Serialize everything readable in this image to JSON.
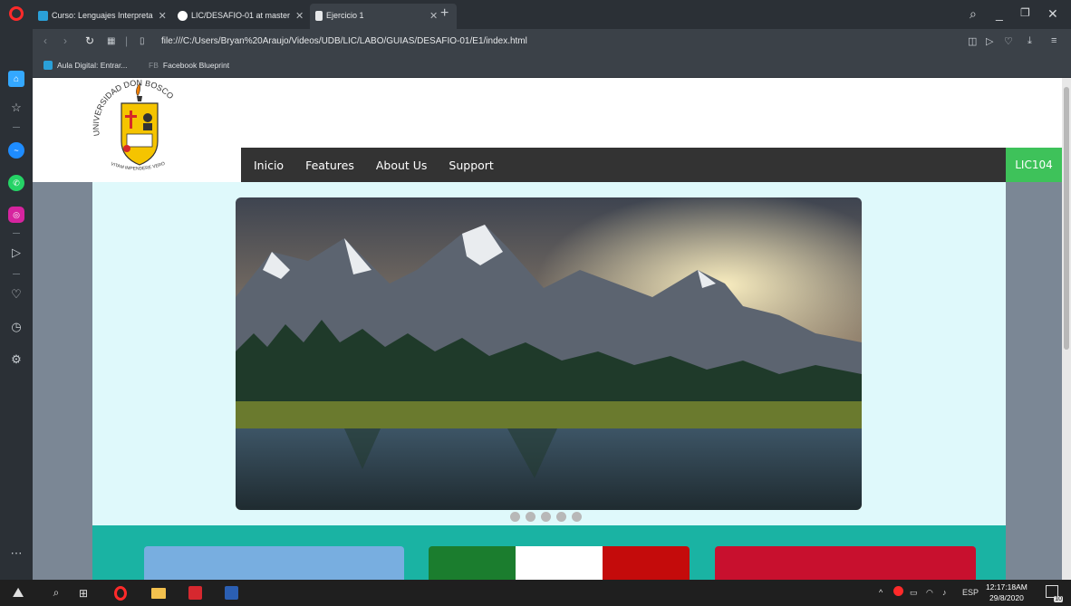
{
  "browser": {
    "tabs": [
      {
        "label": "Curso: Lenguajes Interpreta",
        "active": false
      },
      {
        "label": "LIC/DESAFIO-01 at master",
        "active": false
      },
      {
        "label": "Ejercicio 1",
        "active": true
      }
    ],
    "new_tab_symbol": "+",
    "url": "file:///C:/Users/Bryan%20Araujo/Videos/UDB/LIC/LABO/GUIAS/DESAFIO-01/E1/index.html",
    "bookmarks": [
      {
        "label": "Aula Digital: Entrar..."
      },
      {
        "label": "Facebook Blueprint",
        "prefix": "FB"
      }
    ],
    "accent": "#ff2a2a"
  },
  "page": {
    "logo": {
      "arc_text": "UNIVERSIDAD DON BOSCO",
      "motto": "VITAM IMPENDERE VERO",
      "colors": {
        "shield": "#f5c400",
        "accent": "#d62828"
      }
    },
    "nav": {
      "items": [
        "Inicio",
        "Features",
        "About Us",
        "Support"
      ],
      "badge": "LIC104"
    },
    "colors": {
      "navbar": "#333333",
      "badge": "#3ec25a",
      "content_bg": "#dff9fb",
      "side_bg": "#7b8795",
      "teal_band": "#1ab3a3"
    },
    "carousel": {
      "image": "mountain-lake-landscape",
      "slide_count": 5,
      "active_slide": 1
    },
    "cards": [
      {
        "name": "blue",
        "color": "#78aee0"
      },
      {
        "name": "flag",
        "colors": [
          "#1b7d2e",
          "#ffffff",
          "#c40b0b"
        ]
      },
      {
        "name": "red",
        "color": "#c8102e"
      }
    ]
  },
  "taskbar": {
    "language": "ESP",
    "time": "12:17:18AM",
    "date": "29/8/2020",
    "notifications": "10"
  }
}
